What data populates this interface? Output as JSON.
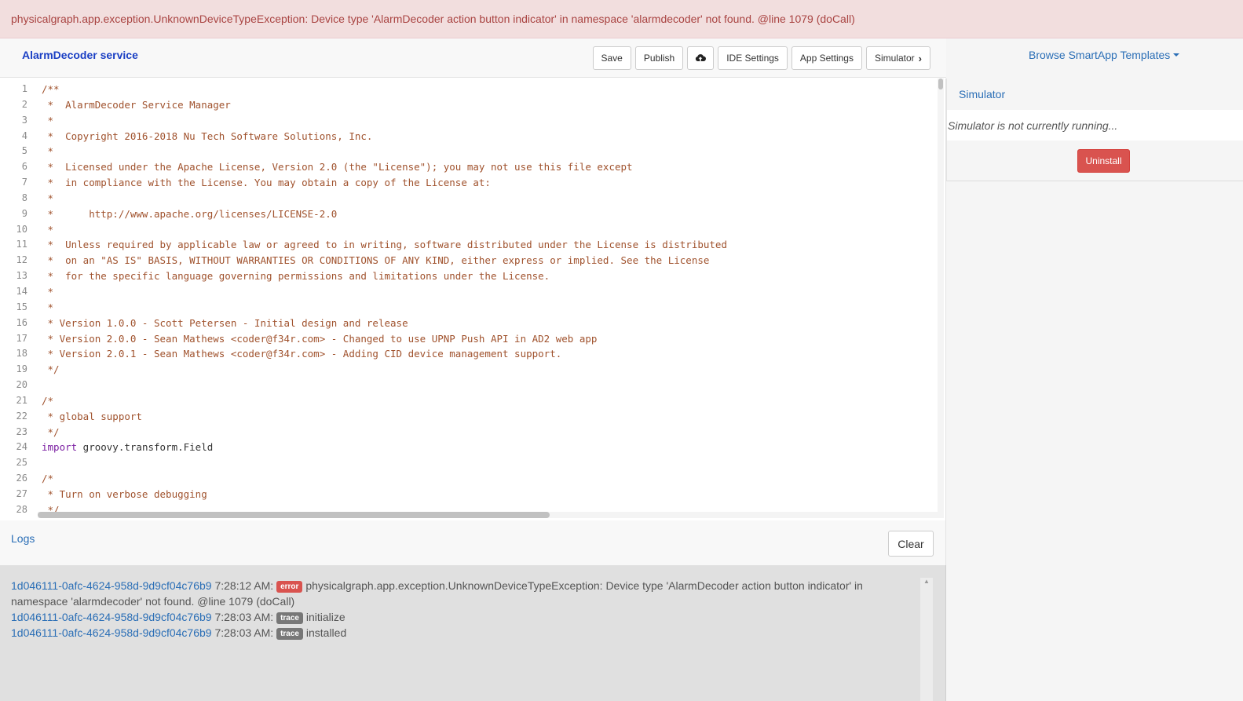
{
  "error_banner": "physicalgraph.app.exception.UnknownDeviceTypeException: Device type 'AlarmDecoder action button indicator' in namespace 'alarmdecoder' not found. @line 1079 (doCall)",
  "header": {
    "title": "AlarmDecoder service",
    "buttons": {
      "save": "Save",
      "publish": "Publish",
      "ide_settings": "IDE Settings",
      "app_settings": "App Settings",
      "simulator": "Simulator"
    },
    "icons": {
      "publish_cloud": "cloud-upload-icon",
      "simulator_chevron": "chevron-right-icon"
    }
  },
  "editor": {
    "line_numbers": [
      "1",
      "2",
      "3",
      "4",
      "5",
      "6",
      "7",
      "8",
      "9",
      "10",
      "11",
      "12",
      "13",
      "14",
      "15",
      "16",
      "17",
      "18",
      "19",
      "20",
      "21",
      "22",
      "23",
      "24",
      "25",
      "26",
      "27",
      "28"
    ],
    "lines": [
      "/**",
      " *  AlarmDecoder Service Manager",
      " *",
      " *  Copyright 2016-2018 Nu Tech Software Solutions, Inc.",
      " *",
      " *  Licensed under the Apache License, Version 2.0 (the \"License\"); you may not use this file except",
      " *  in compliance with the License. You may obtain a copy of the License at:",
      " *",
      " *      http://www.apache.org/licenses/LICENSE-2.0",
      " *",
      " *  Unless required by applicable law or agreed to in writing, software distributed under the License is distributed",
      " *  on an \"AS IS\" BASIS, WITHOUT WARRANTIES OR CONDITIONS OF ANY KIND, either express or implied. See the License",
      " *  for the specific language governing permissions and limitations under the License.",
      " *",
      " *",
      " * Version 1.0.0 - Scott Petersen - Initial design and release",
      " * Version 2.0.0 - Sean Mathews <coder@f34r.com> - Changed to use UPNP Push API in AD2 web app",
      " * Version 2.0.1 - Sean Mathews <coder@f34r.com> - Adding CID device management support.",
      " */",
      "",
      "/*",
      " * global support",
      " */",
      "",
      "",
      "/*",
      " * Turn on verbose debugging",
      " */"
    ],
    "import_line": {
      "keyword": "import",
      "rest": " groovy.transform.Field"
    }
  },
  "logs": {
    "title": "Logs",
    "clear_label": "Clear",
    "entries": [
      {
        "id": "1d046111-0afc-4624-958d-9d9cf04c76b9",
        "time": " 7:28:12 AM: ",
        "level": "error",
        "message": " physicalgraph.app.exception.UnknownDeviceTypeException: Device type 'AlarmDecoder action button indicator' in namespace 'alarmdecoder' not found. @line 1079 (doCall)"
      },
      {
        "id": "1d046111-0afc-4624-958d-9d9cf04c76b9",
        "time": " 7:28:03 AM: ",
        "level": "trace",
        "message": " initialize"
      },
      {
        "id": "1d046111-0afc-4624-958d-9d9cf04c76b9",
        "time": " 7:28:03 AM: ",
        "level": "trace",
        "message": " installed"
      }
    ]
  },
  "right_panel": {
    "browse_label": "Browse SmartApp Templates",
    "simulator_title": "Simulator",
    "simulator_status": "Simulator is not currently running...",
    "uninstall_label": "Uninstall"
  },
  "colors": {
    "error_banner_bg": "#f2dede",
    "error_text": "#a94442",
    "link": "#2a6eb6",
    "title": "#1a3fc4",
    "danger": "#d9534f",
    "comment": "#a0522d",
    "keyword": "#7b1fa2"
  }
}
